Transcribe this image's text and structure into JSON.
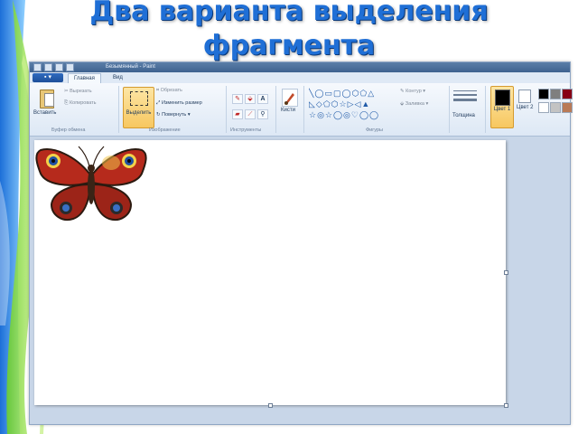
{
  "slide": {
    "title_line1": "Два варианта выделения",
    "title_line2": "фрагмента",
    "title_color": "#1f6fd6"
  },
  "app": {
    "window_title": "Безымянный - Paint",
    "file_button": "▪ ▾",
    "tabs": {
      "home": "Главная",
      "view": "Вид"
    }
  },
  "ribbon": {
    "clipboard": {
      "paste": "Вставить",
      "cut": "Вырезать",
      "copy": "Копировать",
      "group": "Буфер обмена"
    },
    "image": {
      "select": "Выделить",
      "crop": "Обрезать",
      "resize": "Изменить размер",
      "rotate": "Повернуть",
      "group": "Изображение"
    },
    "tools": {
      "group": "Инструменты",
      "text_tool": "A"
    },
    "brushes": {
      "label": "Кисти"
    },
    "shapes": {
      "outline": "Контур",
      "fill": "Заливка",
      "group": "Фигуры",
      "glyphs": "╲◯▭▢◯⬡⬠△\n◺◇⬠⬡☆▷◁▲\n☆◎☆◯◎♡◯◯"
    },
    "thickness": {
      "label": "Толщина"
    },
    "colors": {
      "color1": "Цвет 1",
      "color2": "Цвет 2",
      "color1_value": "#000000",
      "color2_value": "#ffffff",
      "palette": [
        "#000000",
        "#7f7f7f",
        "#880015",
        "#ffffff",
        "#c3c3c3",
        "#b97a57"
      ]
    }
  },
  "canvas": {
    "image_icon": "butterfly-image"
  }
}
